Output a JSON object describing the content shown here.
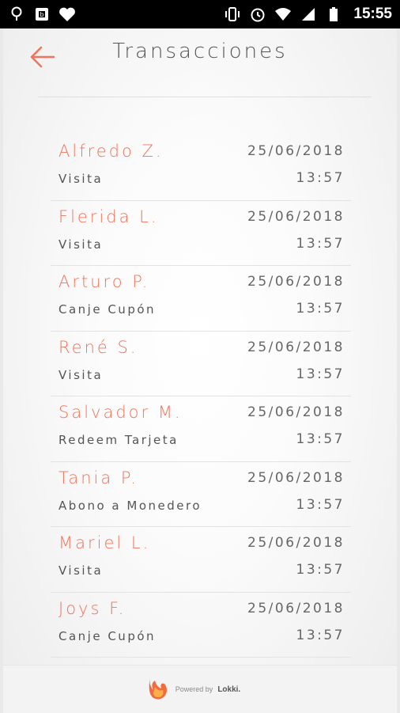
{
  "status_bar": {
    "time": "15:55",
    "icons_left": [
      "location-icon",
      "photo-icon",
      "heart-icon"
    ],
    "icons_right": [
      "vibrate-icon",
      "alarm-icon",
      "wifi-icon",
      "signal-icon",
      "battery-icon"
    ]
  },
  "header": {
    "title": "Transacciones",
    "back_icon": "arrow-left-icon"
  },
  "transactions": [
    {
      "name": "Alfredo Z.",
      "date": "25/06/2018",
      "type": "Visita",
      "time": "13:57"
    },
    {
      "name": "Flerida L.",
      "date": "25/06/2018",
      "type": "Visita",
      "time": "13:57"
    },
    {
      "name": "Arturo P.",
      "date": "25/06/2018",
      "type": "Canje Cupón",
      "time": "13:57"
    },
    {
      "name": "René S.",
      "date": "25/06/2018",
      "type": "Visita",
      "time": "13:57"
    },
    {
      "name": "Salvador M.",
      "date": "25/06/2018",
      "type": "Redeem Tarjeta",
      "time": "13:57"
    },
    {
      "name": "Tania P.",
      "date": "25/06/2018",
      "type": "Abono a Monedero",
      "time": "13:57"
    },
    {
      "name": "Mariel L.",
      "date": "25/06/2018",
      "type": "Visita",
      "time": "13:57"
    },
    {
      "name": "Joys F.",
      "date": "25/06/2018",
      "type": "Canje Cupón",
      "time": "13:57"
    }
  ],
  "footer": {
    "powered_by": "Powered by",
    "brand": "Lokki."
  },
  "colors": {
    "accent": "#f0735a",
    "text": "#555555"
  }
}
